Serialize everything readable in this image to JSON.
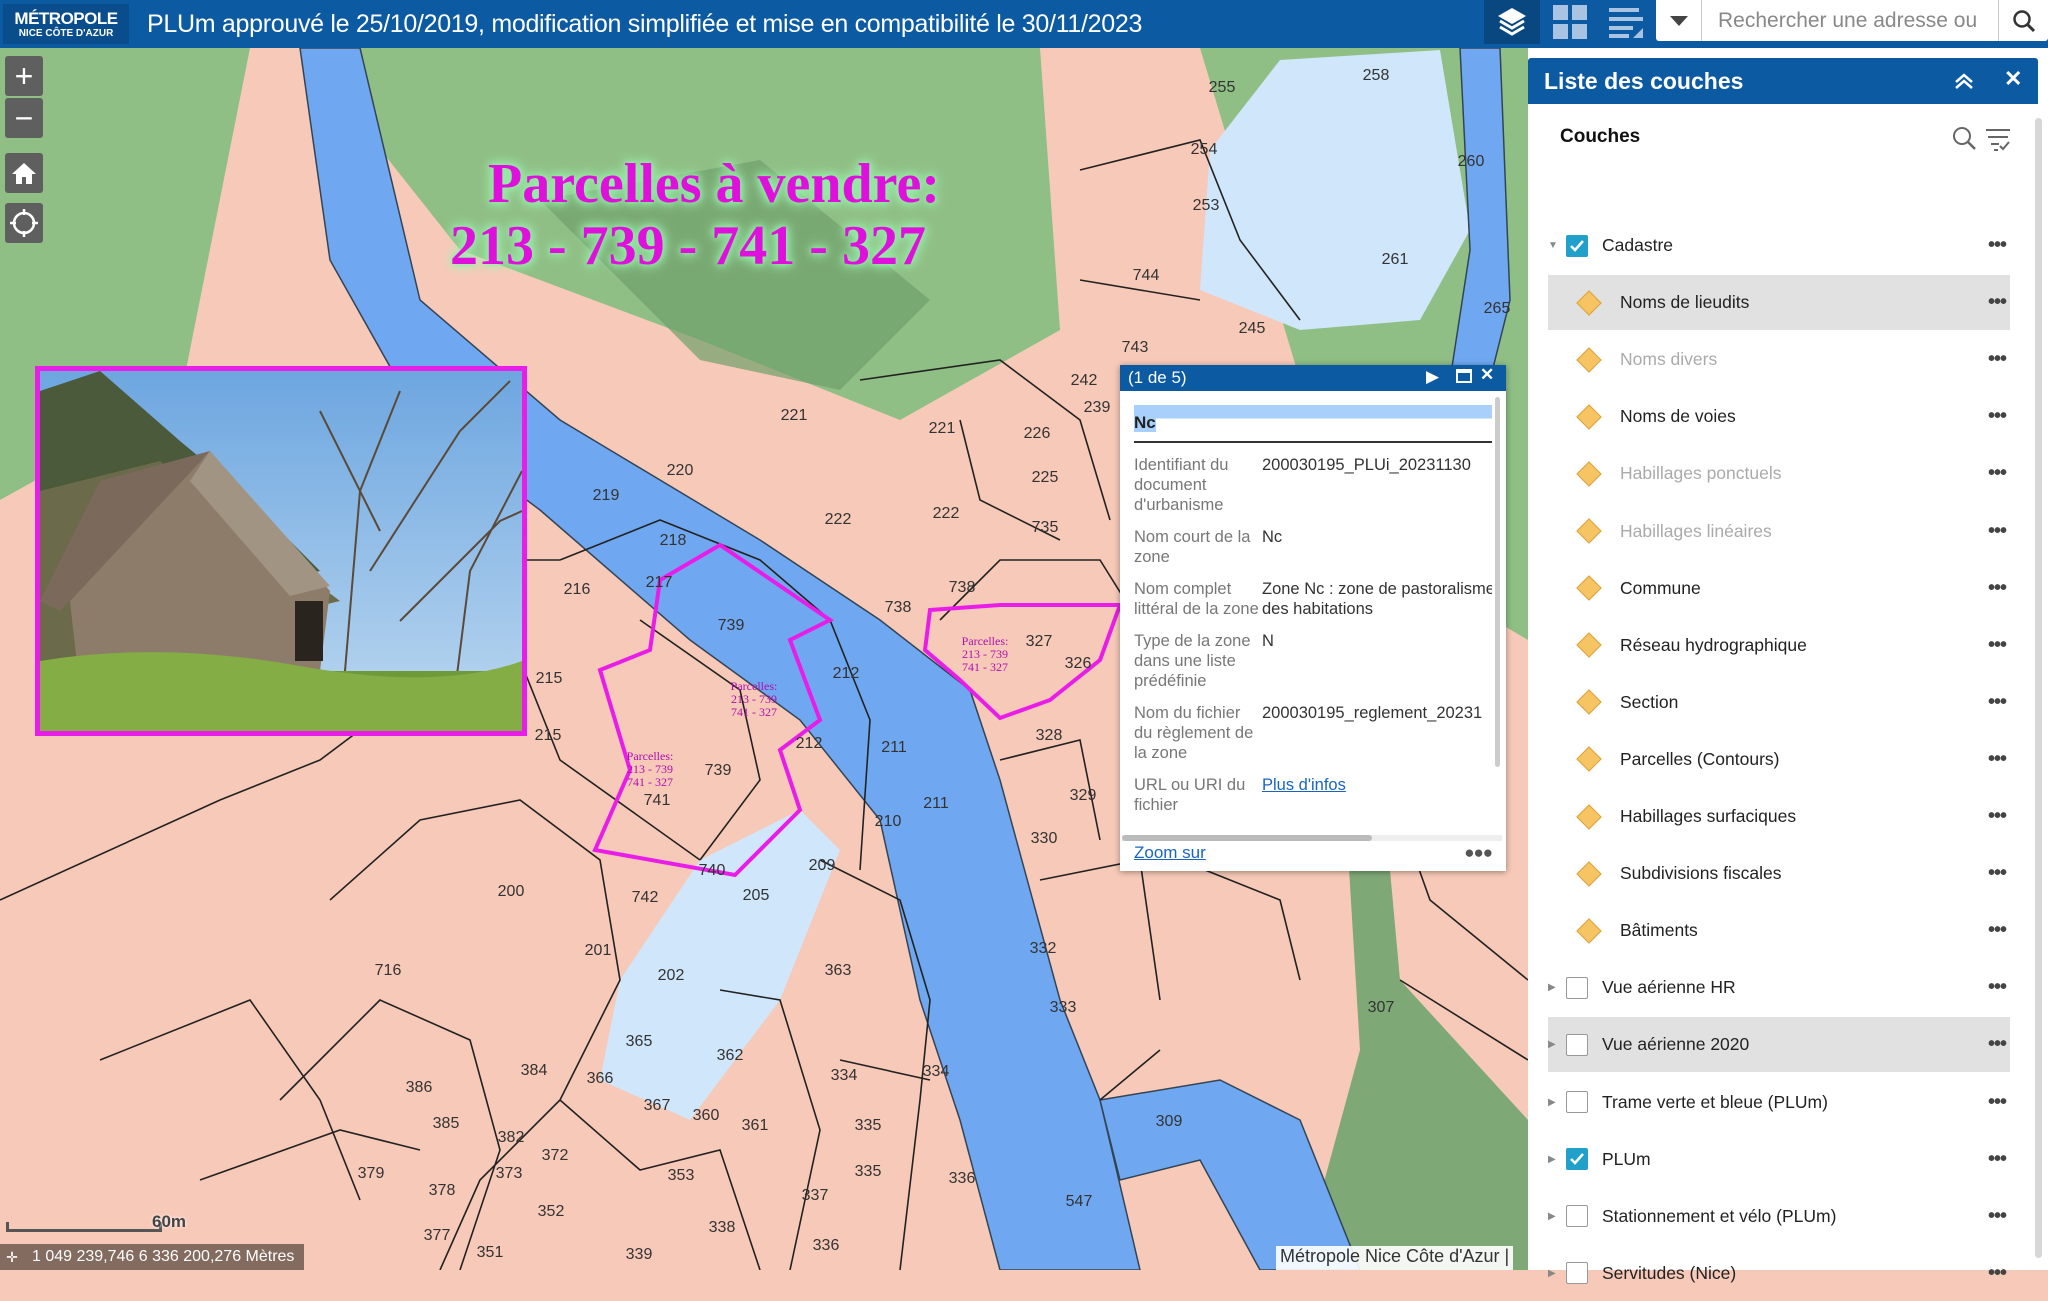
{
  "header": {
    "logo_line1": "MÉTROPOLE",
    "logo_line2": "NICE CÔTE D'AZUR",
    "title": "PLUm approuvé le 25/10/2019, modification simplifiée et mise en compatibilité le 30/11/2023"
  },
  "toolbar": {
    "icons": [
      "layers-icon",
      "grid-icon",
      "legend-icon"
    ],
    "search_placeholder": "Rechercher une adresse ou"
  },
  "map": {
    "overlay_line1": "Parcelles à vendre:",
    "overlay_line2": "213 -  739  - 741 - 327",
    "parcel_note": [
      "Parcelles:",
      "213 - 739",
      "741 - 327"
    ],
    "parcel_labels": [
      "255",
      "258",
      "254",
      "260",
      "253",
      "261",
      "744",
      "245",
      "265",
      "743",
      "242",
      "239",
      "221",
      "221",
      "226",
      "220",
      "219",
      "225",
      "222",
      "222",
      "735",
      "218",
      "217",
      "216",
      "738",
      "738",
      "327",
      "326",
      "739",
      "212",
      "215",
      "215",
      "212",
      "211",
      "328",
      "739",
      "741",
      "210",
      "211",
      "329",
      "330",
      "740",
      "209",
      "200",
      "742",
      "205",
      "716",
      "201",
      "202",
      "363",
      "332",
      "333",
      "307",
      "365",
      "362",
      "384",
      "366",
      "386",
      "367",
      "334",
      "334",
      "360",
      "361",
      "335",
      "309",
      "385",
      "382",
      "372",
      "353",
      "335",
      "336",
      "337",
      "547",
      "379",
      "378",
      "373",
      "352",
      "338",
      "377",
      "351",
      "339",
      "336"
    ],
    "scale_label": "60m",
    "coordinates": "1 049 239,746 6 336 200,276 Mètres",
    "attribution": "Métropole Nice Côte d'Azur |",
    "colors": {
      "zone_n": "#8fbf85",
      "zone_u": "#f7c9b8",
      "river": "#6fa8f0",
      "water_light": "#cfe6fb",
      "parcel_highlight": "#e81ee8",
      "header": "#0b5aa2"
    }
  },
  "popup": {
    "counter": "(1 de 5)",
    "title": "Nc",
    "fields": [
      {
        "label": "Identifiant du document d'urbanisme",
        "value": "200030195_PLUi_20231130"
      },
      {
        "label": "Nom court de la zone",
        "value": "Nc"
      },
      {
        "label": "Nom complet littéral de la zone",
        "value": "Zone Nc : zone de pastoralisme",
        "value2": "des habitations"
      },
      {
        "label": "Type de la zone dans une liste prédéfinie",
        "value": "N"
      },
      {
        "label": "Nom du fichier du règlement de la zone",
        "value": "200030195_reglement_20231"
      },
      {
        "label": "URL ou URI du fichier",
        "value": "Plus d'infos"
      }
    ],
    "zoom_link": "Zoom sur"
  },
  "panel": {
    "title": "Liste des couches",
    "section": "Couches",
    "layers": [
      {
        "label": "Cadastre",
        "type": "group",
        "checked": true,
        "expanded": true
      },
      {
        "label": "Noms de lieudits",
        "type": "sub",
        "highlight": true
      },
      {
        "label": "Noms divers",
        "type": "sub",
        "muted": true
      },
      {
        "label": "Noms de voies",
        "type": "sub"
      },
      {
        "label": "Habillages ponctuels",
        "type": "sub",
        "muted": true
      },
      {
        "label": "Habillages linéaires",
        "type": "sub",
        "muted": true
      },
      {
        "label": "Commune",
        "type": "sub"
      },
      {
        "label": "Réseau hydrographique",
        "type": "sub"
      },
      {
        "label": "Section",
        "type": "sub"
      },
      {
        "label": "Parcelles (Contours)",
        "type": "sub"
      },
      {
        "label": "Habillages surfaciques",
        "type": "sub"
      },
      {
        "label": "Subdivisions fiscales",
        "type": "sub"
      },
      {
        "label": "Bâtiments",
        "type": "sub"
      },
      {
        "label": "Vue aérienne HR",
        "type": "group",
        "checked": false
      },
      {
        "label": "Vue aérienne 2020",
        "type": "group",
        "checked": false,
        "highlight": true
      },
      {
        "label": "Trame verte et bleue (PLUm)",
        "type": "group",
        "checked": false
      },
      {
        "label": "PLUm",
        "type": "group",
        "checked": true
      },
      {
        "label": "Stationnement et vélo (PLUm)",
        "type": "group",
        "checked": false
      },
      {
        "label": "Servitudes (Nice)",
        "type": "group",
        "checked": false
      }
    ]
  }
}
